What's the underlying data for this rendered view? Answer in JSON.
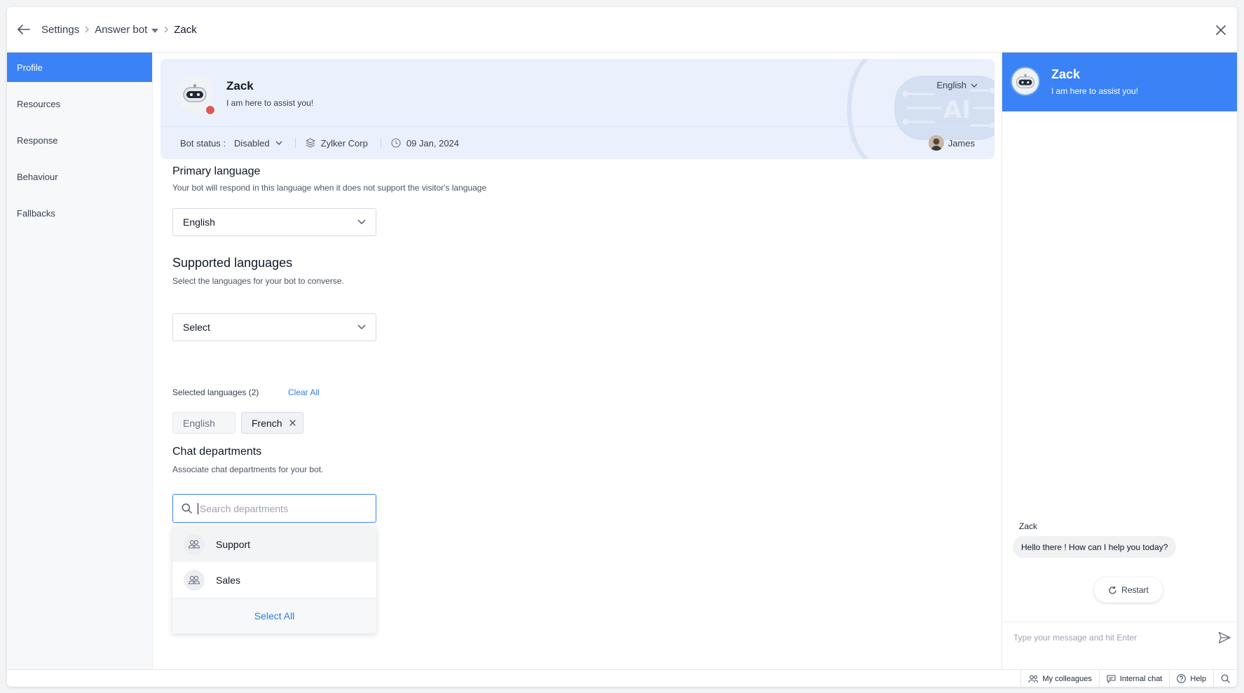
{
  "breadcrumb": {
    "items": [
      "Settings",
      "Answer bot"
    ],
    "current": "Zack"
  },
  "nav": {
    "items": [
      {
        "label": "Profile",
        "active": true
      },
      {
        "label": "Resources",
        "active": false
      },
      {
        "label": "Response",
        "active": false
      },
      {
        "label": "Behaviour",
        "active": false
      },
      {
        "label": "Fallbacks",
        "active": false
      }
    ]
  },
  "profile": {
    "name": "Zack",
    "tagline": "I am here to assist you!",
    "language": "English",
    "status_label": "Bot status :",
    "status_value": "Disabled",
    "company": "Zylker Corp",
    "date": "09 Jan, 2024",
    "owner": "James",
    "status_color": "#e25555"
  },
  "primary_language": {
    "title": "Primary language",
    "description": "Your bot will respond in this language when it does not support the visitor's language",
    "value": "English"
  },
  "supported_languages": {
    "title": "Supported languages",
    "description": "Select the languages for your bot to converse.",
    "placeholder": "Select",
    "selected_label": "Selected languages (2)",
    "clear_all": "Clear All",
    "chips": [
      {
        "label": "English",
        "removable": false
      },
      {
        "label": "French",
        "removable": true
      }
    ]
  },
  "chat_departments": {
    "title": "Chat departments",
    "description": "Associate chat departments for your bot.",
    "search_placeholder": "Search departments",
    "options": [
      "Support",
      "Sales"
    ],
    "select_all": "Select All"
  },
  "preview": {
    "bot_name": "Zack",
    "tagline": "I am here to assist you!",
    "sender": "Zack",
    "message": "Hello there ! How can I help you today?",
    "restart_label": "Restart",
    "input_placeholder": "Type your message and hit Enter",
    "header_color": "#3b82f6"
  },
  "bottom_bar": {
    "items": [
      "My colleagues",
      "Internal chat",
      "Help"
    ]
  }
}
